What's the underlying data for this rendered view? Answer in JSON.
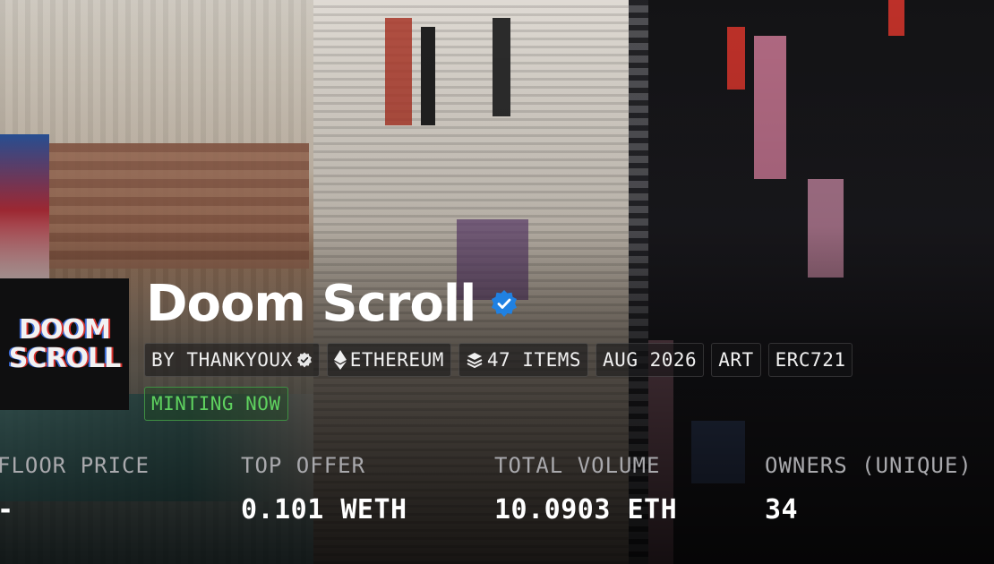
{
  "collection": {
    "avatar_text_line1": "DOOM",
    "avatar_text_line2": "SCROLL",
    "name": "Doom Scroll",
    "verified": true
  },
  "tags": {
    "creator": "BY THANKYOUX",
    "chain": "ETHEREUM",
    "items": "47 ITEMS",
    "date": "AUG 2026",
    "category": "ART",
    "standard": "ERC721"
  },
  "status": {
    "minting": "MINTING NOW"
  },
  "stats": [
    {
      "label": "FLOOR PRICE",
      "value": "-"
    },
    {
      "label": "TOP OFFER",
      "value": "0.101 WETH"
    },
    {
      "label": "TOTAL VOLUME",
      "value": "10.0903 ETH"
    },
    {
      "label": "OWNERS (UNIQUE)",
      "value": "34"
    }
  ],
  "icons": {
    "verified": "verified-badge-icon",
    "chain": "ethereum-icon",
    "items": "layers-icon"
  },
  "colors": {
    "verified_blue": "#2081e2",
    "minting_green": "#5fd25f"
  }
}
